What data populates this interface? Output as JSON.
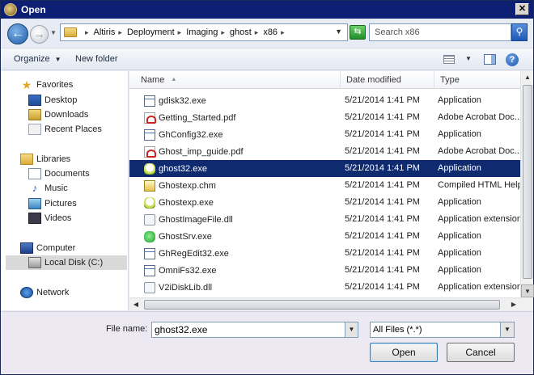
{
  "window": {
    "title": "Open",
    "close_glyph": "✕"
  },
  "address": {
    "back_glyph": "←",
    "forward_glyph": "→",
    "breadcrumbs": [
      "Altiris",
      "Deployment",
      "Imaging",
      "ghost",
      "x86"
    ],
    "crumb_separator": "▸",
    "search_placeholder": "Search x86"
  },
  "toolbar": {
    "organize_label": "Organize",
    "new_folder_label": "New folder",
    "help_glyph": "?"
  },
  "nav": {
    "favorites": "Favorites",
    "desktop": "Desktop",
    "downloads": "Downloads",
    "recent": "Recent Places",
    "libraries": "Libraries",
    "documents": "Documents",
    "music": "Music",
    "pictures": "Pictures",
    "videos": "Videos",
    "computer": "Computer",
    "local_disk": "Local Disk (C:)",
    "network": "Network"
  },
  "columns": {
    "name": "Name",
    "date": "Date modified",
    "type": "Type"
  },
  "files": [
    {
      "name": "gdisk32.exe",
      "date": "5/21/2014 1:41 PM",
      "type": "Application",
      "icon": "app"
    },
    {
      "name": "Getting_Started.pdf",
      "date": "5/21/2014 1:41 PM",
      "type": "Adobe Acrobat Doc...",
      "icon": "pdf"
    },
    {
      "name": "GhConfig32.exe",
      "date": "5/21/2014 1:41 PM",
      "type": "Application",
      "icon": "app"
    },
    {
      "name": "Ghost_imp_guide.pdf",
      "date": "5/21/2014 1:41 PM",
      "type": "Adobe Acrobat Doc...",
      "icon": "pdf"
    },
    {
      "name": "ghost32.exe",
      "date": "5/21/2014 1:41 PM",
      "type": "Application",
      "icon": "ghost",
      "selected": true
    },
    {
      "name": "Ghostexp.chm",
      "date": "5/21/2014 1:41 PM",
      "type": "Compiled HTML Help...",
      "icon": "chm"
    },
    {
      "name": "Ghostexp.exe",
      "date": "5/21/2014 1:41 PM",
      "type": "Application",
      "icon": "ghost"
    },
    {
      "name": "GhostImageFile.dll",
      "date": "5/21/2014 1:41 PM",
      "type": "Application extension",
      "icon": "dll"
    },
    {
      "name": "GhostSrv.exe",
      "date": "5/21/2014 1:41 PM",
      "type": "Application",
      "icon": "green"
    },
    {
      "name": "GhRegEdit32.exe",
      "date": "5/21/2014 1:41 PM",
      "type": "Application",
      "icon": "app"
    },
    {
      "name": "OmniFs32.exe",
      "date": "5/21/2014 1:41 PM",
      "type": "Application",
      "icon": "app"
    },
    {
      "name": "V2iDiskLib.dll",
      "date": "5/21/2014 1:41 PM",
      "type": "Application extension",
      "icon": "dll"
    }
  ],
  "bottom": {
    "file_name_label": "File name:",
    "file_name_value": "ghost32.exe",
    "file_type_value": "All Files (*.*)",
    "open_label": "Open",
    "cancel_label": "Cancel"
  }
}
